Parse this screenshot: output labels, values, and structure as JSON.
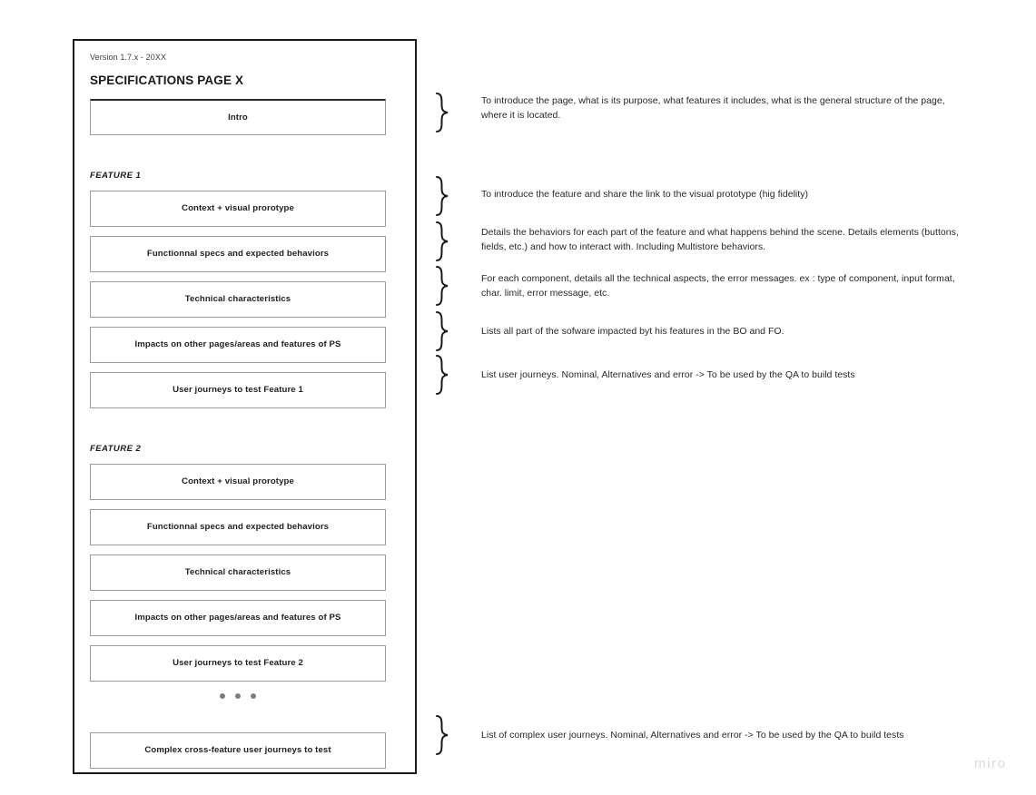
{
  "document": {
    "version_line": "Version 1.7.x - 20XX",
    "title": "SPECIFICATIONS PAGE X",
    "intro_box": "Intro",
    "feature1_heading": "FEATURE 1",
    "feature2_heading": "FEATURE 2",
    "feature1_boxes": [
      "Context + visual prorotype",
      "Functionnal specs and expected behaviors",
      "Technical characteristics",
      "Impacts on other pages/areas and features of PS",
      "User journeys to test Feature 1"
    ],
    "feature2_boxes": [
      "Context + visual prorotype",
      "Functionnal specs and expected behaviors",
      "Technical characteristics",
      "Impacts on other pages/areas and features of PS",
      "User journeys to test Feature 2"
    ],
    "ellipsis_dots": 3,
    "final_box": "Complex cross-feature user journeys to test"
  },
  "annotations": [
    {
      "id": "intro",
      "text": "To introduce the page, what is its purpose, what features it includes, what is the general structure of the page, where it is located."
    },
    {
      "id": "context-visual-prototype",
      "text": "To introduce the feature and share the link to the visual prototype (hig fidelity)"
    },
    {
      "id": "functional-specs",
      "text": "Details the behaviors for each part of the feature and what happens behind the scene. Details elements (buttons, fields, etc.) and how to interact with. Including Multistore behaviors."
    },
    {
      "id": "technical-characteristics",
      "text": "For each component, details all the technical aspects, the error messages. ex : type of component, input format, char. limit, error message, etc."
    },
    {
      "id": "impacts",
      "text": "Lists all part of the sofware impacted byt his features in the BO and FO."
    },
    {
      "id": "user-journeys",
      "text": "List user journeys. Nominal, Alternatives and error -> To be used by the QA to build tests"
    },
    {
      "id": "complex-user-journeys",
      "text": "List of complex user journeys. Nominal, Alternatives and error -> To be used by the QA to build tests"
    }
  ],
  "watermark": {
    "label": "miro"
  },
  "colors": {
    "frame_border": "#1a1a1a",
    "box_border": "#9b9b9b",
    "text": "#1f1f1f",
    "annotation_text": "#25282b",
    "dot": "#7d7d7d",
    "watermark": "#d8dade",
    "background": "#ffffff"
  }
}
